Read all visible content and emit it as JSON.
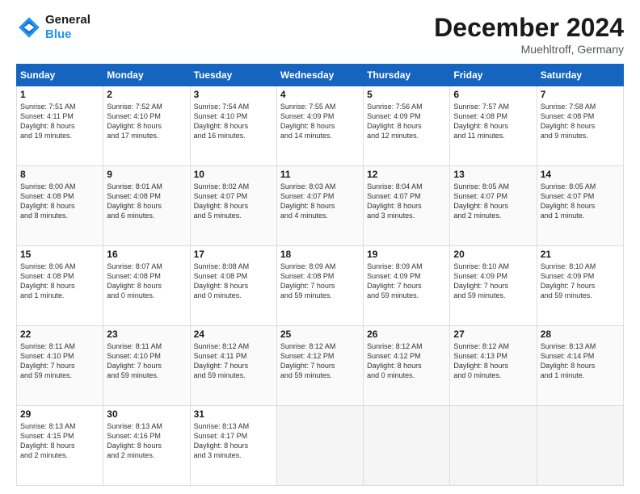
{
  "header": {
    "logo_line1": "General",
    "logo_line2": "Blue",
    "month": "December 2024",
    "location": "Muehltroff, Germany"
  },
  "days_of_week": [
    "Sunday",
    "Monday",
    "Tuesday",
    "Wednesday",
    "Thursday",
    "Friday",
    "Saturday"
  ],
  "weeks": [
    [
      {
        "day": "1",
        "lines": [
          "Sunrise: 7:51 AM",
          "Sunset: 4:11 PM",
          "Daylight: 8 hours",
          "and 19 minutes."
        ]
      },
      {
        "day": "2",
        "lines": [
          "Sunrise: 7:52 AM",
          "Sunset: 4:10 PM",
          "Daylight: 8 hours",
          "and 17 minutes."
        ]
      },
      {
        "day": "3",
        "lines": [
          "Sunrise: 7:54 AM",
          "Sunset: 4:10 PM",
          "Daylight: 8 hours",
          "and 16 minutes."
        ]
      },
      {
        "day": "4",
        "lines": [
          "Sunrise: 7:55 AM",
          "Sunset: 4:09 PM",
          "Daylight: 8 hours",
          "and 14 minutes."
        ]
      },
      {
        "day": "5",
        "lines": [
          "Sunrise: 7:56 AM",
          "Sunset: 4:09 PM",
          "Daylight: 8 hours",
          "and 12 minutes."
        ]
      },
      {
        "day": "6",
        "lines": [
          "Sunrise: 7:57 AM",
          "Sunset: 4:08 PM",
          "Daylight: 8 hours",
          "and 11 minutes."
        ]
      },
      {
        "day": "7",
        "lines": [
          "Sunrise: 7:58 AM",
          "Sunset: 4:08 PM",
          "Daylight: 8 hours",
          "and 9 minutes."
        ]
      }
    ],
    [
      {
        "day": "8",
        "lines": [
          "Sunrise: 8:00 AM",
          "Sunset: 4:08 PM",
          "Daylight: 8 hours",
          "and 8 minutes."
        ]
      },
      {
        "day": "9",
        "lines": [
          "Sunrise: 8:01 AM",
          "Sunset: 4:08 PM",
          "Daylight: 8 hours",
          "and 6 minutes."
        ]
      },
      {
        "day": "10",
        "lines": [
          "Sunrise: 8:02 AM",
          "Sunset: 4:07 PM",
          "Daylight: 8 hours",
          "and 5 minutes."
        ]
      },
      {
        "day": "11",
        "lines": [
          "Sunrise: 8:03 AM",
          "Sunset: 4:07 PM",
          "Daylight: 8 hours",
          "and 4 minutes."
        ]
      },
      {
        "day": "12",
        "lines": [
          "Sunrise: 8:04 AM",
          "Sunset: 4:07 PM",
          "Daylight: 8 hours",
          "and 3 minutes."
        ]
      },
      {
        "day": "13",
        "lines": [
          "Sunrise: 8:05 AM",
          "Sunset: 4:07 PM",
          "Daylight: 8 hours",
          "and 2 minutes."
        ]
      },
      {
        "day": "14",
        "lines": [
          "Sunrise: 8:05 AM",
          "Sunset: 4:07 PM",
          "Daylight: 8 hours",
          "and 1 minute."
        ]
      }
    ],
    [
      {
        "day": "15",
        "lines": [
          "Sunrise: 8:06 AM",
          "Sunset: 4:08 PM",
          "Daylight: 8 hours",
          "and 1 minute."
        ]
      },
      {
        "day": "16",
        "lines": [
          "Sunrise: 8:07 AM",
          "Sunset: 4:08 PM",
          "Daylight: 8 hours",
          "and 0 minutes."
        ]
      },
      {
        "day": "17",
        "lines": [
          "Sunrise: 8:08 AM",
          "Sunset: 4:08 PM",
          "Daylight: 8 hours",
          "and 0 minutes."
        ]
      },
      {
        "day": "18",
        "lines": [
          "Sunrise: 8:09 AM",
          "Sunset: 4:08 PM",
          "Daylight: 7 hours",
          "and 59 minutes."
        ]
      },
      {
        "day": "19",
        "lines": [
          "Sunrise: 8:09 AM",
          "Sunset: 4:09 PM",
          "Daylight: 7 hours",
          "and 59 minutes."
        ]
      },
      {
        "day": "20",
        "lines": [
          "Sunrise: 8:10 AM",
          "Sunset: 4:09 PM",
          "Daylight: 7 hours",
          "and 59 minutes."
        ]
      },
      {
        "day": "21",
        "lines": [
          "Sunrise: 8:10 AM",
          "Sunset: 4:09 PM",
          "Daylight: 7 hours",
          "and 59 minutes."
        ]
      }
    ],
    [
      {
        "day": "22",
        "lines": [
          "Sunrise: 8:11 AM",
          "Sunset: 4:10 PM",
          "Daylight: 7 hours",
          "and 59 minutes."
        ]
      },
      {
        "day": "23",
        "lines": [
          "Sunrise: 8:11 AM",
          "Sunset: 4:10 PM",
          "Daylight: 7 hours",
          "and 59 minutes."
        ]
      },
      {
        "day": "24",
        "lines": [
          "Sunrise: 8:12 AM",
          "Sunset: 4:11 PM",
          "Daylight: 7 hours",
          "and 59 minutes."
        ]
      },
      {
        "day": "25",
        "lines": [
          "Sunrise: 8:12 AM",
          "Sunset: 4:12 PM",
          "Daylight: 7 hours",
          "and 59 minutes."
        ]
      },
      {
        "day": "26",
        "lines": [
          "Sunrise: 8:12 AM",
          "Sunset: 4:12 PM",
          "Daylight: 8 hours",
          "and 0 minutes."
        ]
      },
      {
        "day": "27",
        "lines": [
          "Sunrise: 8:12 AM",
          "Sunset: 4:13 PM",
          "Daylight: 8 hours",
          "and 0 minutes."
        ]
      },
      {
        "day": "28",
        "lines": [
          "Sunrise: 8:13 AM",
          "Sunset: 4:14 PM",
          "Daylight: 8 hours",
          "and 1 minute."
        ]
      }
    ],
    [
      {
        "day": "29",
        "lines": [
          "Sunrise: 8:13 AM",
          "Sunset: 4:15 PM",
          "Daylight: 8 hours",
          "and 2 minutes."
        ]
      },
      {
        "day": "30",
        "lines": [
          "Sunrise: 8:13 AM",
          "Sunset: 4:16 PM",
          "Daylight: 8 hours",
          "and 2 minutes."
        ]
      },
      {
        "day": "31",
        "lines": [
          "Sunrise: 8:13 AM",
          "Sunset: 4:17 PM",
          "Daylight: 8 hours",
          "and 3 minutes."
        ]
      },
      null,
      null,
      null,
      null
    ]
  ]
}
